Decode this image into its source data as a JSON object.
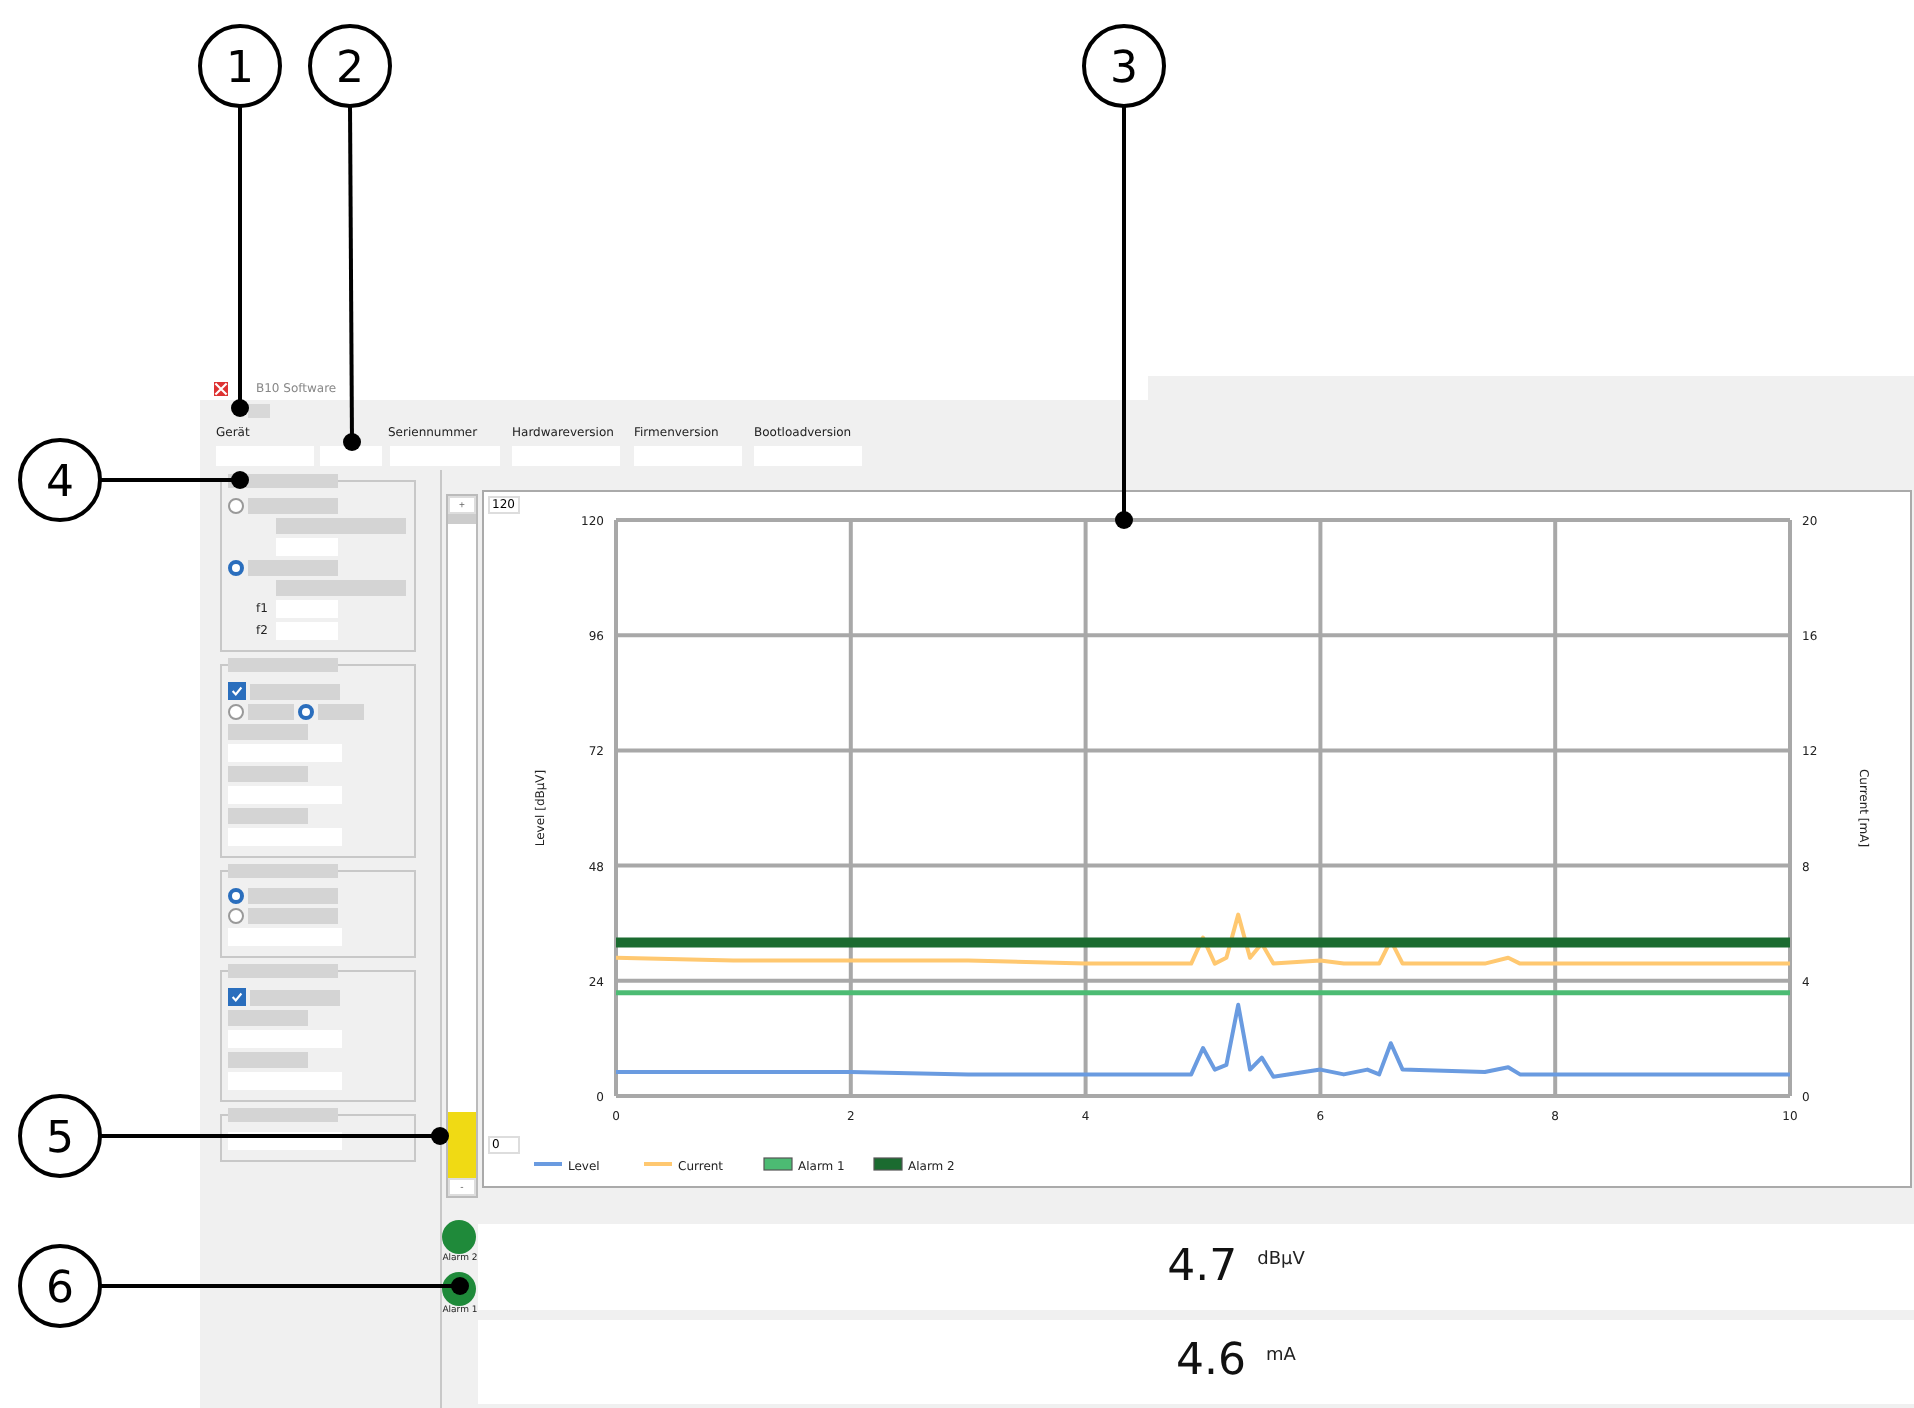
{
  "window": {
    "title": "B10 Software"
  },
  "device_fields": [
    {
      "kind": "text_field",
      "label": "Gerät"
    },
    {
      "kind": "text_field"
    },
    {
      "kind": "text_field",
      "label": "Seriennummer"
    },
    {
      "kind": "text_field",
      "label": "Hardwareversion"
    },
    {
      "kind": "text_field",
      "label": "Firmenversion"
    },
    {
      "kind": "text_field",
      "label": "Bootloadversion"
    }
  ],
  "left_panel": {
    "groups": [
      {
        "items": [
          {
            "kind": "radio",
            "selected": false
          },
          {
            "kind": "blank",
            "indent": true
          },
          {
            "kind": "field",
            "indent": true
          },
          {
            "kind": "radio",
            "selected": true
          },
          {
            "kind": "blank",
            "indent": true
          },
          {
            "kind": "field",
            "indent": true,
            "label": "f1"
          },
          {
            "kind": "field",
            "indent": true,
            "label": "f2"
          }
        ]
      },
      {
        "items": [
          {
            "kind": "checkbox",
            "checked": true
          },
          {
            "kind": "radio_pair",
            "options": [
              {
                "selected": false
              },
              {
                "selected": true
              }
            ]
          },
          {
            "kind": "blank"
          },
          {
            "kind": "field"
          },
          {
            "kind": "blank"
          },
          {
            "kind": "field"
          },
          {
            "kind": "blank"
          },
          {
            "kind": "field"
          }
        ]
      },
      {
        "items": [
          {
            "kind": "radio",
            "selected": true
          },
          {
            "kind": "radio",
            "selected": false
          },
          {
            "kind": "field"
          }
        ]
      },
      {
        "items": [
          {
            "kind": "checkbox",
            "checked": true
          },
          {
            "kind": "blank"
          },
          {
            "kind": "field"
          },
          {
            "kind": "blank"
          },
          {
            "kind": "field"
          }
        ]
      },
      {
        "items": [
          {
            "kind": "field"
          }
        ]
      }
    ]
  },
  "meter": {
    "plus": "+",
    "minus": "-",
    "level": 0.1
  },
  "scale_fields": {
    "max": "120",
    "min": "0"
  },
  "chart": {
    "chart_data": {
      "type": "line",
      "ylabel": "Level [dBµV]",
      "y2label": "Current [mA]",
      "x": [
        0,
        1,
        2,
        3,
        4,
        4.9,
        5.0,
        5.1,
        5.2,
        5.3,
        5.4,
        5.5,
        5.6,
        6.0,
        6.2,
        6.4,
        6.5,
        6.6,
        6.7,
        7.4,
        7.6,
        7.7,
        8,
        9,
        10
      ],
      "xlim": [
        0,
        10
      ],
      "ylim": [
        0,
        120
      ],
      "y2lim": [
        0,
        20
      ],
      "xticks": [
        0,
        2,
        4,
        6,
        8,
        10
      ],
      "yticks": [
        0,
        24,
        48,
        72,
        96,
        120
      ],
      "y2ticks": [
        0,
        4,
        8,
        12,
        16,
        20
      ],
      "series": [
        {
          "name": "Level",
          "color": "#6a9be0",
          "values": [
            5,
            5,
            5,
            4.5,
            4.5,
            4.5,
            10,
            5.5,
            6.5,
            19,
            5.5,
            8,
            4,
            5.5,
            4.5,
            5.5,
            4.5,
            11,
            5.5,
            5,
            6,
            4.5,
            4.5,
            4.5,
            4.5
          ]
        },
        {
          "name": "Current",
          "color": "#ffc870",
          "axis": "y2",
          "values": [
            4.8,
            4.7,
            4.7,
            4.7,
            4.6,
            4.6,
            5.5,
            4.6,
            4.8,
            6.3,
            4.8,
            5.3,
            4.6,
            4.7,
            4.6,
            4.6,
            4.6,
            5.4,
            4.6,
            4.6,
            4.8,
            4.6,
            4.6,
            4.6,
            4.6
          ]
        },
        {
          "name": "Alarm 1",
          "color": "#4cbb73",
          "values": [
            21.5,
            21.5,
            21.5,
            21.5,
            21.5,
            21.5,
            21.5,
            21.5,
            21.5,
            21.5,
            21.5,
            21.5,
            21.5,
            21.5,
            21.5,
            21.5,
            21.5,
            21.5,
            21.5,
            21.5,
            21.5,
            21.5,
            21.5,
            21.5,
            21.5
          ]
        },
        {
          "name": "Alarm 2",
          "color": "#1b6b30",
          "values": [
            32,
            32,
            32,
            32,
            32,
            32,
            32,
            32,
            32,
            32,
            32,
            32,
            32,
            32,
            32,
            32,
            32,
            32,
            32,
            32,
            32,
            32,
            32,
            32,
            32
          ]
        }
      ],
      "grid": true,
      "legend": true
    }
  },
  "alarms": [
    {
      "label": "Alarm 2",
      "active": true
    },
    {
      "label": "Alarm 1",
      "active": true
    }
  ],
  "readouts": [
    {
      "value": "4.7",
      "unit": "dBµV"
    },
    {
      "value": "4.6",
      "unit": "mA"
    }
  ],
  "callouts": [
    {
      "number": "1"
    },
    {
      "number": "2"
    },
    {
      "number": "3"
    },
    {
      "number": "4"
    },
    {
      "number": "5"
    },
    {
      "number": "6"
    }
  ]
}
